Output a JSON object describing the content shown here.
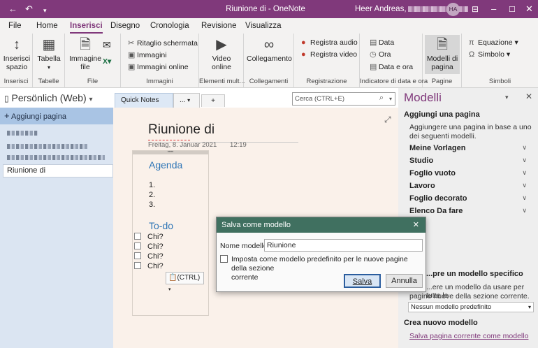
{
  "titlebar": {
    "back_icon": "back-arrow-icon",
    "undo_icon": "undo-icon",
    "qat_icon": "quick-access-dropdown-icon",
    "title": "Riunione di  -  OneNote",
    "user": "Heer Andreas,",
    "avatar_initials": "HA",
    "accent": "#80397b"
  },
  "menu_tabs": [
    "File",
    "Home",
    "Inserisci",
    "Disegno",
    "Cronologia",
    "Revisione",
    "Visualizza"
  ],
  "ribbon": {
    "groups": [
      "Inserisci",
      "Tabelle",
      "File",
      "Immagini",
      "Elementi mult...",
      "Collegamenti",
      "Registrazione",
      "Indicatore di data e ora",
      "Pagine",
      "Simboli"
    ],
    "insert_space": "Inserisci spazio",
    "table": "Tabella",
    "file_image": "Immagine file",
    "screen_clip": "Ritaglio schermata",
    "images": "Immagini",
    "online_images": "Immagini online",
    "online_video": "Video online",
    "link": "Collegamento",
    "record_audio": "Registra audio",
    "record_video": "Registra video",
    "date": "Data",
    "time": "Ora",
    "date_time": "Data e ora",
    "page_templates": "Modelli di pagina",
    "equation": "Equazione",
    "symbol": "Simbolo"
  },
  "notebook": {
    "name": "Persönlich (Web)",
    "add_page": "Aggiungi pagina",
    "current_page": "Riunione di"
  },
  "sections": {
    "tab1": "Quick Notes",
    "tab2": "...",
    "add": "+"
  },
  "search": {
    "placeholder": "Cerca (CTRL+E)"
  },
  "page": {
    "title": "Riunione di",
    "date": "Freitag, 8. Januar 2021",
    "time": "12:19",
    "agenda": "Agenda",
    "list": [
      "1.",
      "2.",
      "3."
    ],
    "todo": "To-do",
    "todo_items": [
      "Chi?",
      "Chi?",
      "Chi?",
      "Chi?"
    ],
    "paste_option": "(CTRL)"
  },
  "templates_pane": {
    "title": "Modelli",
    "add_page_header": "Aggiungi una pagina",
    "add_page_desc": "Aggiungere una pagina in base a uno dei seguenti modelli.",
    "categories": [
      "Meine Vorlagen",
      "Studio",
      "Foglio vuoto",
      "Lavoro",
      "Foglio decorato",
      "Elenco Da fare"
    ],
    "specific_header": "...pre un modello specifico",
    "specific_desc_1": "...ere un modello da usare per tutte le",
    "specific_desc_2": "pagine nuove della sezione corrente.",
    "default_select": "Nessun modello predefinito",
    "create_header": "Crea nuovo modello",
    "save_link": "Salva pagina corrente come modello"
  },
  "dialog": {
    "title": "Salva come modello",
    "name_label": "Nome modello:",
    "name_value": "Riunione",
    "checkbox_label_1": "Imposta come modello predefinito per le nuove pagine della sezione",
    "checkbox_label_2": "corrente",
    "save": "Salva",
    "cancel": "Annulla",
    "title_color": "#407060"
  }
}
